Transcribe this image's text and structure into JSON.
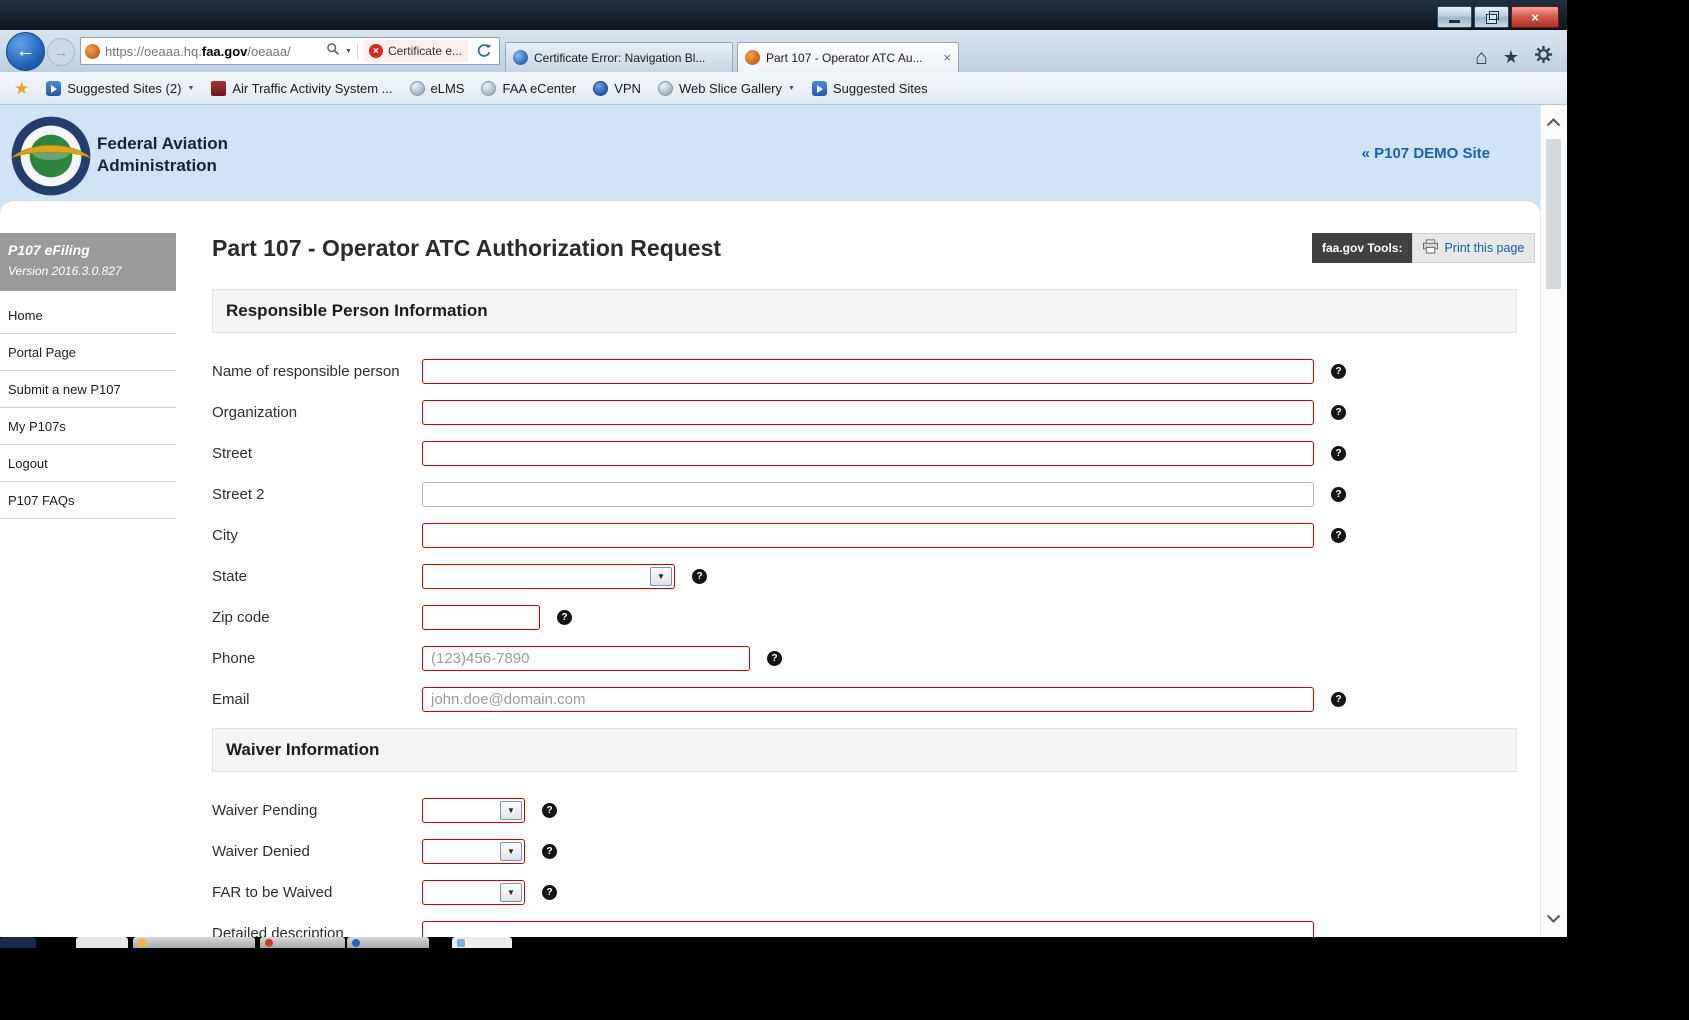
{
  "icons": {
    "help": "?",
    "back": "←",
    "forward": "→",
    "home": "⌂",
    "star": "★",
    "dropdown": "▼",
    "select_arrow": "▼",
    "close": "×",
    "cert_x": "×",
    "tab_close": "×"
  },
  "colors": {
    "required_field_border": "#cc0000",
    "link_blue": "#1a5dba",
    "faa_header_bg": "#cfe4f7",
    "sidebar_header_bg": "#9a9a9a"
  },
  "browser": {
    "address": {
      "url_prefix": "https://oeaaa.hq.",
      "url_domain": "faa.gov",
      "url_suffix": "/oeaaa/",
      "cert_error_label": "Certificate e..."
    },
    "tabs": [
      {
        "label": "Certificate Error: Navigation Bl..."
      },
      {
        "label": "Part 107 - Operator ATC Au..."
      }
    ],
    "favorites": [
      {
        "label": "Suggested Sites (2)"
      },
      {
        "label": "Air Traffic Activity System ..."
      },
      {
        "label": "eLMS"
      },
      {
        "label": "FAA eCenter"
      },
      {
        "label": "VPN"
      },
      {
        "label": "Web Slice Gallery"
      },
      {
        "label": "Suggested Sites"
      }
    ]
  },
  "site_header": {
    "agency_line1": "Federal Aviation",
    "agency_line2": "Administration",
    "demo_link": "« P107 DEMO Site"
  },
  "sidebar": {
    "app_title": "P107 eFiling",
    "version": "Version 2016.3.0.827",
    "items": [
      "Home",
      "Portal Page",
      "Submit a new P107",
      "My P107s",
      "Logout",
      "P107 FAQs"
    ]
  },
  "content": {
    "page_title": "Part 107 - Operator ATC Authorization Request",
    "tools_label": "faa.gov Tools:",
    "print_label": "Print this page",
    "responsible_section": {
      "title": "Responsible Person Information",
      "name_label": "Name of responsible person",
      "organization_label": "Organization",
      "street_label": "Street",
      "street2_label": "Street 2",
      "city_label": "City",
      "state_label": "State",
      "zip_label": "Zip code",
      "phone_label": "Phone",
      "phone_placeholder": "(123)456-7890",
      "email_label": "Email",
      "email_placeholder": "john.doe@domain.com"
    },
    "waiver_section": {
      "title": "Waiver Information",
      "waiver_pending_label": "Waiver Pending",
      "waiver_denied_label": "Waiver Denied",
      "far_label": "FAR to be Waived",
      "detailed_description_label": "Detailed description"
    }
  }
}
